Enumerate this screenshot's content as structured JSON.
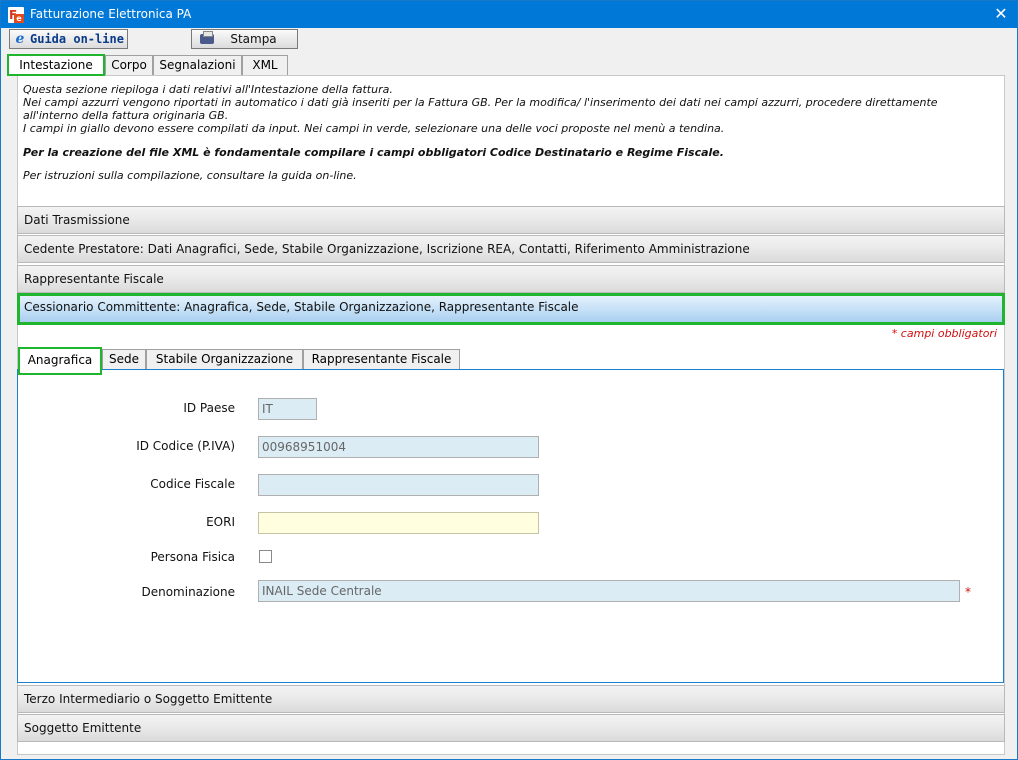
{
  "window": {
    "title": "Fatturazione Elettronica PA",
    "icon_letters": "F",
    "icon_sub": "e",
    "close_glyph": "✕"
  },
  "toolbar": {
    "guide_label": "Guida on-line",
    "guide_icon_glyph": "e",
    "print_label": "Stampa"
  },
  "main_tabs": [
    {
      "label": "Intestazione",
      "active": true
    },
    {
      "label": "Corpo",
      "active": false
    },
    {
      "label": "Segnalazioni",
      "active": false
    },
    {
      "label": "XML",
      "active": false
    }
  ],
  "intro": {
    "line1": "Questa sezione riepiloga i dati relativi all'Intestazione della fattura.",
    "line2": "Nei campi azzurri vengono riportati in automatico i dati già inseriti per la Fattura GB. Per la modifica/ l'inserimento dei dati nei campi azzurri, procedere direttamente all'interno della fattura originaria GB.",
    "line3": "I campi in giallo devono essere compilati da input. Nei campi in verde, selezionare una delle voci proposte nel menù a tendina.",
    "bold": "Per la creazione del file XML è fondamentale compilare i campi obbligatori Codice Destinatario e Regime Fiscale.",
    "hint": "Per istruzioni sulla compilazione, consultare la guida on-line."
  },
  "sections": [
    {
      "label": "Dati Trasmissione"
    },
    {
      "label": "Cedente Prestatore: Dati Anagrafici, Sede, Stabile Organizzazione, Iscrizione REA, Contatti, Riferimento Amministrazione"
    },
    {
      "label": "Rappresentante Fiscale"
    },
    {
      "label": "Cessionario Committente: Anagrafica, Sede, Stabile Organizzazione, Rappresentante Fiscale"
    },
    {
      "label": "Terzo Intermediario o Soggetto Emittente"
    },
    {
      "label": "Soggetto Emittente"
    }
  ],
  "required_note": "* campi obbligatori",
  "sub_tabs": [
    {
      "label": "Anagrafica",
      "active": true
    },
    {
      "label": "Sede",
      "active": false
    },
    {
      "label": "Stabile Organizzazione",
      "active": false
    },
    {
      "label": "Rappresentante Fiscale",
      "active": false
    }
  ],
  "form": {
    "id_paese": {
      "label": "ID Paese",
      "value": "IT"
    },
    "id_codice": {
      "label": "ID Codice (P.IVA)",
      "value": "00968951004"
    },
    "codice_fiscale": {
      "label": "Codice Fiscale",
      "value": ""
    },
    "eori": {
      "label": "EORI",
      "value": ""
    },
    "persona_fisica": {
      "label": "Persona Fisica",
      "checked": false
    },
    "denominazione": {
      "label": "Denominazione",
      "value": "INAIL Sede Centrale",
      "required_mark": "*"
    }
  },
  "colors": {
    "titlebar": "#0078d7",
    "highlight_border": "#1fb52f",
    "blue_field": "#dbecf5",
    "yellow_field": "#ffffe0",
    "required": "#d01010"
  }
}
